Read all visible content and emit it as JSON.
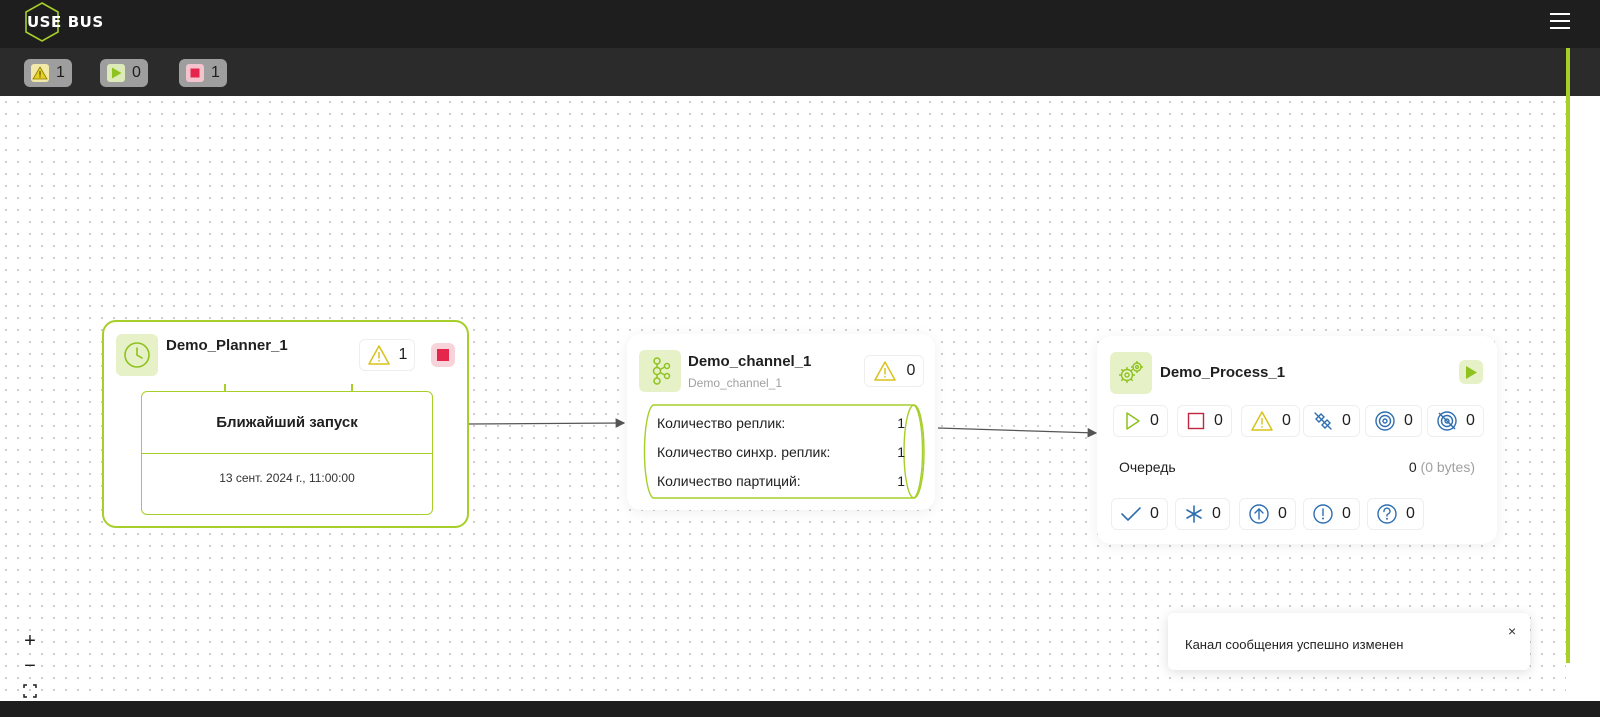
{
  "app": {
    "logo_part1": "USE",
    "logo_part2": "BUS"
  },
  "status_counters": [
    {
      "icon": "warning-icon",
      "value": "1"
    },
    {
      "icon": "play-icon",
      "value": "0"
    },
    {
      "icon": "stop-icon",
      "value": "1"
    }
  ],
  "colors": {
    "accent": "#a6cf2a",
    "header_bg": "#1e1e1e",
    "warning": "#e6cf1e",
    "stop": "#e5254b",
    "play": "#8ec21f",
    "process_stat_icons": "#2f6fb0"
  },
  "planner": {
    "title": "Demo_Planner_1",
    "icon": "clock-icon",
    "warning_count": "1",
    "next_run_label": "Ближайший запуск",
    "next_run_date": "13 сент. 2024 г., 11:00:00"
  },
  "channel": {
    "title": "Demo_channel_1",
    "subtitle": "Demo_channel_1",
    "icon": "kafka-icon",
    "warning_count": "0",
    "rows": [
      {
        "label": "Количество реплик:",
        "value": "1"
      },
      {
        "label": "Количество синхр. реплик:",
        "value": "1"
      },
      {
        "label": "Количество партиций:",
        "value": "1"
      }
    ]
  },
  "process": {
    "title": "Demo_Process_1",
    "icon": "gears-icon",
    "state_counters": [
      {
        "icon": "play-outline-icon",
        "value": "0"
      },
      {
        "icon": "stop-outline-icon",
        "value": "0"
      },
      {
        "icon": "warning-icon",
        "value": "0"
      },
      {
        "icon": "disconnected-icon",
        "value": "0"
      },
      {
        "icon": "target-icon",
        "value": "0"
      },
      {
        "icon": "target-off-icon",
        "value": "0"
      }
    ],
    "queue_label": "Очередь",
    "queue_count": "0",
    "queue_bytes": "(0 bytes)",
    "message_counters": [
      {
        "icon": "check-icon",
        "value": "0"
      },
      {
        "icon": "asterisk-icon",
        "value": "0"
      },
      {
        "icon": "arrow-up-circle-icon",
        "value": "0"
      },
      {
        "icon": "exclamation-circle-icon",
        "value": "0"
      },
      {
        "icon": "question-circle-icon",
        "value": "0"
      }
    ]
  },
  "zoom": {
    "zoom_in": "+",
    "zoom_out": "−"
  },
  "toast": {
    "message": "Канал сообщения успешно изменен",
    "close": "×"
  }
}
